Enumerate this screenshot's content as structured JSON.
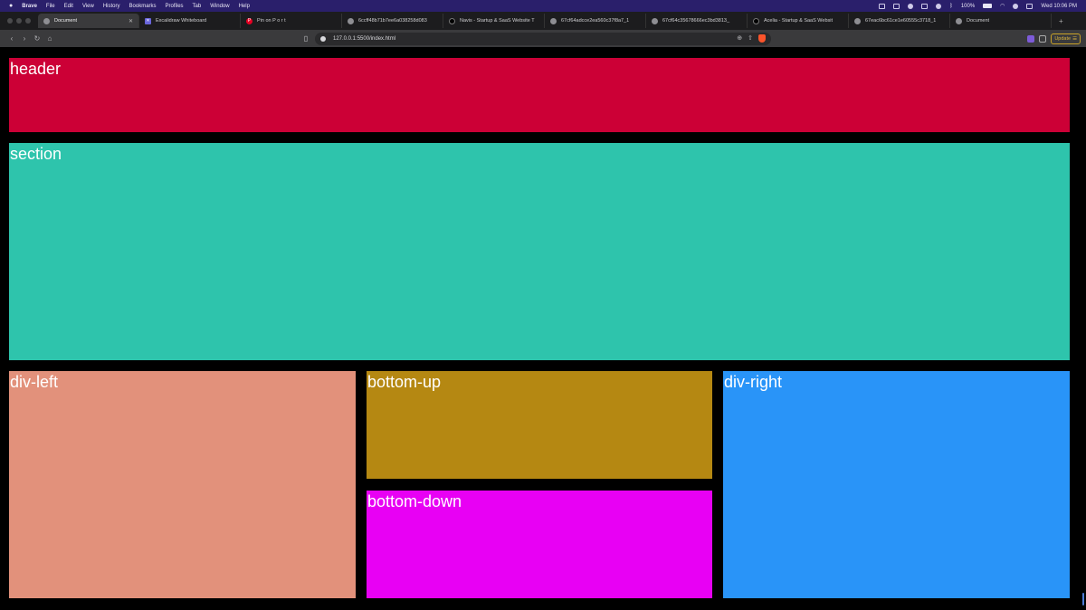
{
  "menubar": {
    "app": "Brave",
    "items": [
      "File",
      "Edit",
      "View",
      "History",
      "Bookmarks",
      "Profiles",
      "Tab",
      "Window",
      "Help"
    ],
    "battery": "100%",
    "clock": "Wed 10:06 PM"
  },
  "tabs": [
    {
      "label": "Document",
      "active": true,
      "icon": "globe-icon"
    },
    {
      "label": "Excalidraw Whiteboard",
      "active": false,
      "icon": "excalidraw-icon"
    },
    {
      "label": "Pin on P o r t",
      "active": false,
      "icon": "pinterest-icon"
    },
    {
      "label": "6ccff48b71b7ee6a038258d083",
      "active": false,
      "icon": "globe-icon"
    },
    {
      "label": "Navis - Startup & SaaS Website T",
      "active": false,
      "icon": "framer-icon"
    },
    {
      "label": "67cf64adcce2ea560c37f8a7_1",
      "active": false,
      "icon": "globe-icon"
    },
    {
      "label": "67cf64c35678666ec3bd3813_",
      "active": false,
      "icon": "globe-icon"
    },
    {
      "label": "Acelia - Startup & SaaS Websit",
      "active": false,
      "icon": "framer-icon"
    },
    {
      "label": "67eac6bc61ce1e60555c3718_1",
      "active": false,
      "icon": "globe-icon"
    },
    {
      "label": "Document",
      "active": false,
      "icon": "globe-icon"
    }
  ],
  "toolbar": {
    "url": "127.0.0.1:5500/index.html",
    "update_label": "Update"
  },
  "page": {
    "header": "header",
    "section": "section",
    "div_left": "div-left",
    "bottom_up": "bottom-up",
    "bottom_down": "bottom-down",
    "div_right": "div-right"
  },
  "colors": {
    "header": "#cc0036",
    "section": "#2ec4ac",
    "div_left": "#e2917b",
    "bottom_up": "#b58812",
    "bottom_down": "#e800f4",
    "div_right": "#2994f8",
    "background": "#000000"
  }
}
